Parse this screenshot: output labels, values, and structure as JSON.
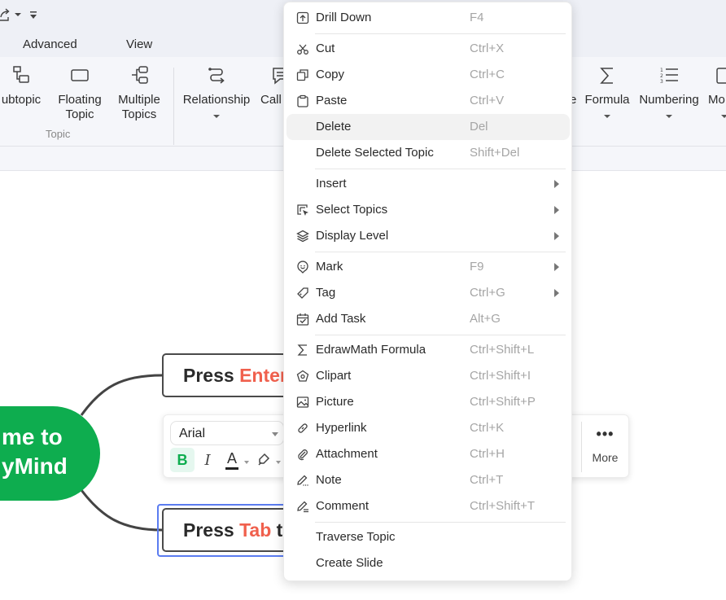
{
  "quick_access": {
    "share_icon": "share-export-icon",
    "customize_icon": "customize-quick-access-icon"
  },
  "ribbon_tabs": [
    {
      "label": "Advanced"
    },
    {
      "label": "View"
    }
  ],
  "ribbon": {
    "buttons": [
      {
        "id": "subtopic",
        "label_line1": "ubtopic",
        "label_line2": "",
        "icon": "subtopic-icon",
        "has_dropdown": false
      },
      {
        "id": "floating-topic",
        "label_line1": "Floating",
        "label_line2": "Topic",
        "icon": "floating-topic-icon",
        "has_dropdown": false
      },
      {
        "id": "multiple-topics",
        "label_line1": "Multiple",
        "label_line2": "Topics",
        "icon": "multiple-topics-icon",
        "has_dropdown": false
      },
      {
        "id": "relationship",
        "label_line1": "Relationship",
        "label_line2": "",
        "icon": "relationship-icon",
        "has_dropdown": true
      },
      {
        "id": "callout",
        "label_line1": "Call",
        "label_line2": "",
        "icon": "callout-icon",
        "has_dropdown": false
      },
      {
        "id": "partial",
        "label_line1": "e",
        "label_line2": "",
        "icon": "",
        "has_dropdown": false
      },
      {
        "id": "formula",
        "label_line1": "Formula",
        "label_line2": "",
        "icon": "sigma-icon",
        "has_dropdown": true
      },
      {
        "id": "numbering",
        "label_line1": "Numbering",
        "label_line2": "",
        "icon": "numbered-list-icon",
        "has_dropdown": true
      },
      {
        "id": "more-partial",
        "label_line1": "Mo",
        "label_line2": "",
        "icon": "more-icon",
        "has_dropdown": true
      }
    ],
    "group_label": "Topic"
  },
  "mindmap": {
    "central_topic": {
      "line1": "me to",
      "line2": "yMind"
    },
    "topics": [
      {
        "prefix": "Press ",
        "highlight": "Enter",
        "suffix": "",
        "selected": false
      },
      {
        "prefix": "Press ",
        "highlight": "Tab",
        "suffix": " t",
        "selected": true
      }
    ],
    "colors": {
      "central": "#0ead4f",
      "highlight": "#f0604d",
      "selection": "#5b7cf0"
    }
  },
  "text_toolbar": {
    "font_value": "Arial",
    "bold_label": "B",
    "italic_label": "I",
    "font_color_label": "A",
    "more_dots": "•••",
    "more_label": "More"
  },
  "context_menu": {
    "items": [
      {
        "label": "Drill Down",
        "shortcut": "F4",
        "icon": "drill-down-icon",
        "submenu": false,
        "hover": false
      },
      {
        "label": "Cut",
        "shortcut": "Ctrl+X",
        "icon": "scissors-icon",
        "submenu": false,
        "hover": false
      },
      {
        "label": "Copy",
        "shortcut": "Ctrl+C",
        "icon": "copy-icon",
        "submenu": false,
        "hover": false
      },
      {
        "label": "Paste",
        "shortcut": "Ctrl+V",
        "icon": "clipboard-icon",
        "submenu": false,
        "hover": false
      },
      {
        "label": "Delete",
        "shortcut": "Del",
        "icon": "",
        "submenu": false,
        "hover": true
      },
      {
        "label": "Delete Selected Topic",
        "shortcut": "Shift+Del",
        "icon": "",
        "submenu": false,
        "hover": false
      },
      {
        "label": "Insert",
        "shortcut": "",
        "icon": "",
        "submenu": true,
        "hover": false
      },
      {
        "label": "Select Topics",
        "shortcut": "",
        "icon": "select-topics-icon",
        "submenu": true,
        "hover": false
      },
      {
        "label": "Display Level",
        "shortcut": "",
        "icon": "layers-icon",
        "submenu": true,
        "hover": false
      },
      {
        "label": "Mark",
        "shortcut": "F9",
        "icon": "smiley-mark-icon",
        "submenu": true,
        "hover": false
      },
      {
        "label": "Tag",
        "shortcut": "Ctrl+G",
        "icon": "tag-icon",
        "submenu": true,
        "hover": false
      },
      {
        "label": "Add Task",
        "shortcut": "Alt+G",
        "icon": "calendar-check-icon",
        "submenu": false,
        "hover": false
      },
      {
        "label": "EdrawMath Formula",
        "shortcut": "Ctrl+Shift+L",
        "icon": "sigma-icon",
        "submenu": false,
        "hover": false
      },
      {
        "label": "Clipart",
        "shortcut": "Ctrl+Shift+I",
        "icon": "clipart-icon",
        "submenu": false,
        "hover": false
      },
      {
        "label": "Picture",
        "shortcut": "Ctrl+Shift+P",
        "icon": "picture-icon",
        "submenu": false,
        "hover": false
      },
      {
        "label": "Hyperlink",
        "shortcut": "Ctrl+K",
        "icon": "link-icon",
        "submenu": false,
        "hover": false
      },
      {
        "label": "Attachment",
        "shortcut": "Ctrl+H",
        "icon": "paperclip-icon",
        "submenu": false,
        "hover": false
      },
      {
        "label": "Note",
        "shortcut": "Ctrl+T",
        "icon": "note-pen-icon",
        "submenu": false,
        "hover": false
      },
      {
        "label": "Comment",
        "shortcut": "Ctrl+Shift+T",
        "icon": "comment-pen-icon",
        "submenu": false,
        "hover": false
      },
      {
        "label": "Traverse Topic",
        "shortcut": "",
        "icon": "",
        "submenu": false,
        "hover": false
      },
      {
        "label": "Create Slide",
        "shortcut": "",
        "icon": "",
        "submenu": false,
        "hover": false
      }
    ]
  }
}
